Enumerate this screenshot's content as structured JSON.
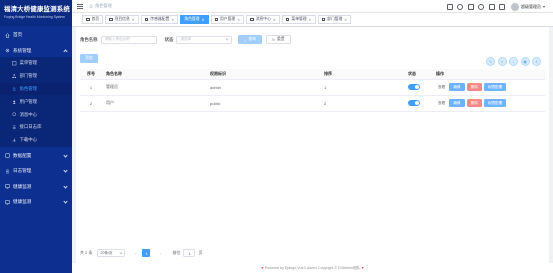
{
  "app": {
    "title": "福清大桥健康监测系统",
    "subtitle": "Fuqing Bridge Health Monitoring System"
  },
  "sidebar": {
    "items": [
      {
        "label": "首页",
        "icon": "home-icon"
      },
      {
        "label": "系统管理",
        "icon": "gear-icon",
        "expanded": true
      },
      {
        "label": "菜单管理",
        "icon": "menu-icon"
      },
      {
        "label": "部门管理",
        "icon": "org-icon"
      },
      {
        "label": "角色管理",
        "icon": "role-icon",
        "active": true
      },
      {
        "label": "用户管理",
        "icon": "user-icon"
      },
      {
        "label": "消息中心",
        "icon": "message-icon"
      },
      {
        "label": "接口日志库",
        "icon": "log-icon"
      },
      {
        "label": "下载中心",
        "icon": "download-icon"
      },
      {
        "label": "数据配置",
        "icon": "data-icon"
      },
      {
        "label": "日志管理",
        "icon": "log-icon"
      },
      {
        "label": "健康监测",
        "icon": "monitor-icon"
      },
      {
        "label": "健康监测",
        "icon": "monitor-icon"
      }
    ]
  },
  "header": {
    "breadcrumb": "角色管理",
    "user": "超级管理员"
  },
  "tabs": [
    {
      "label": "首页",
      "closable": false
    },
    {
      "label": "项目信息",
      "closable": true
    },
    {
      "label": "传感器配置",
      "closable": true
    },
    {
      "label": "角色管理",
      "closable": true,
      "active": true
    },
    {
      "label": "用户管理",
      "closable": true
    },
    {
      "label": "消息中心",
      "closable": true
    },
    {
      "label": "菜单管理",
      "closable": true
    },
    {
      "label": "部门管理",
      "closable": true
    }
  ],
  "search": {
    "role_label": "角色名称",
    "role_placeholder": "请输入角色名称",
    "status_label": "状态",
    "status_placeholder": "请选择",
    "search_btn": "查询",
    "reset_btn": "重置"
  },
  "toolbar": {
    "add_btn": "添加"
  },
  "table": {
    "headers": [
      "序号",
      "角色名称",
      "权限标识",
      "排序",
      "状态",
      "操作"
    ],
    "rows": [
      {
        "no": "1",
        "name": "管理员",
        "key": "admin",
        "sort": "1",
        "status": true
      },
      {
        "no": "2",
        "name": "用户",
        "key": "public",
        "sort": "2",
        "status": true
      }
    ],
    "ops": {
      "view": "查看",
      "edit": "编辑",
      "delete": "删除",
      "perm": "权限配置"
    }
  },
  "pager": {
    "total": "共 2 条",
    "page_size": "20条/页",
    "current": "1",
    "goto_label": "前往",
    "goto_value": "1",
    "page_unit": "页"
  },
  "footer": {
    "text": "Powered by Django-Vue3-Admin Copyright © DVAdmin团队"
  },
  "colors": {
    "sidebar_bg": "#0d2f8f",
    "primary": "#409eff",
    "danger": "#f78989"
  }
}
